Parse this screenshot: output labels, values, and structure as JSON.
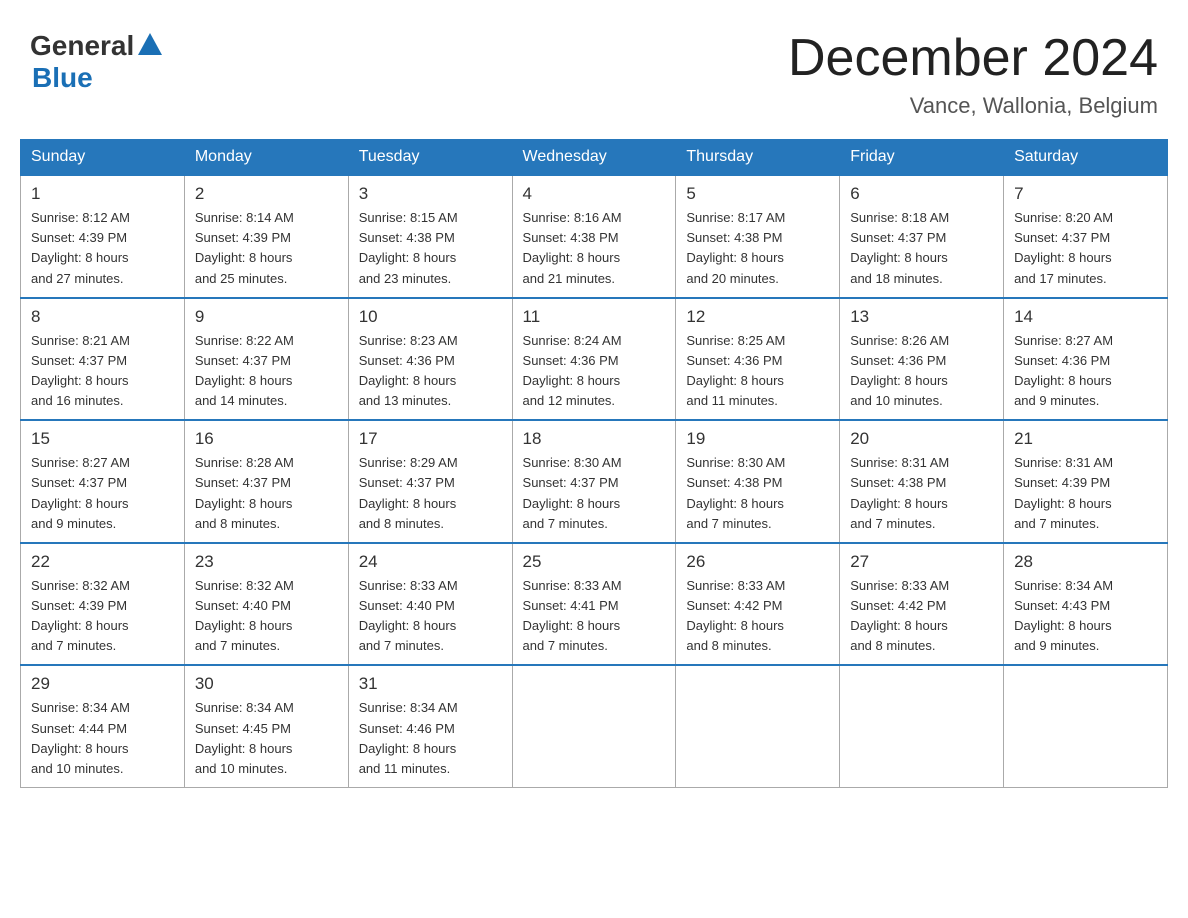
{
  "header": {
    "logo_general": "General",
    "logo_blue": "Blue",
    "title": "December 2024",
    "subtitle": "Vance, Wallonia, Belgium"
  },
  "days_of_week": [
    "Sunday",
    "Monday",
    "Tuesday",
    "Wednesday",
    "Thursday",
    "Friday",
    "Saturday"
  ],
  "weeks": [
    [
      {
        "day": "1",
        "sunrise": "8:12 AM",
        "sunset": "4:39 PM",
        "daylight": "8 hours and 27 minutes."
      },
      {
        "day": "2",
        "sunrise": "8:14 AM",
        "sunset": "4:39 PM",
        "daylight": "8 hours and 25 minutes."
      },
      {
        "day": "3",
        "sunrise": "8:15 AM",
        "sunset": "4:38 PM",
        "daylight": "8 hours and 23 minutes."
      },
      {
        "day": "4",
        "sunrise": "8:16 AM",
        "sunset": "4:38 PM",
        "daylight": "8 hours and 21 minutes."
      },
      {
        "day": "5",
        "sunrise": "8:17 AM",
        "sunset": "4:38 PM",
        "daylight": "8 hours and 20 minutes."
      },
      {
        "day": "6",
        "sunrise": "8:18 AM",
        "sunset": "4:37 PM",
        "daylight": "8 hours and 18 minutes."
      },
      {
        "day": "7",
        "sunrise": "8:20 AM",
        "sunset": "4:37 PM",
        "daylight": "8 hours and 17 minutes."
      }
    ],
    [
      {
        "day": "8",
        "sunrise": "8:21 AM",
        "sunset": "4:37 PM",
        "daylight": "8 hours and 16 minutes."
      },
      {
        "day": "9",
        "sunrise": "8:22 AM",
        "sunset": "4:37 PM",
        "daylight": "8 hours and 14 minutes."
      },
      {
        "day": "10",
        "sunrise": "8:23 AM",
        "sunset": "4:36 PM",
        "daylight": "8 hours and 13 minutes."
      },
      {
        "day": "11",
        "sunrise": "8:24 AM",
        "sunset": "4:36 PM",
        "daylight": "8 hours and 12 minutes."
      },
      {
        "day": "12",
        "sunrise": "8:25 AM",
        "sunset": "4:36 PM",
        "daylight": "8 hours and 11 minutes."
      },
      {
        "day": "13",
        "sunrise": "8:26 AM",
        "sunset": "4:36 PM",
        "daylight": "8 hours and 10 minutes."
      },
      {
        "day": "14",
        "sunrise": "8:27 AM",
        "sunset": "4:36 PM",
        "daylight": "8 hours and 9 minutes."
      }
    ],
    [
      {
        "day": "15",
        "sunrise": "8:27 AM",
        "sunset": "4:37 PM",
        "daylight": "8 hours and 9 minutes."
      },
      {
        "day": "16",
        "sunrise": "8:28 AM",
        "sunset": "4:37 PM",
        "daylight": "8 hours and 8 minutes."
      },
      {
        "day": "17",
        "sunrise": "8:29 AM",
        "sunset": "4:37 PM",
        "daylight": "8 hours and 8 minutes."
      },
      {
        "day": "18",
        "sunrise": "8:30 AM",
        "sunset": "4:37 PM",
        "daylight": "8 hours and 7 minutes."
      },
      {
        "day": "19",
        "sunrise": "8:30 AM",
        "sunset": "4:38 PM",
        "daylight": "8 hours and 7 minutes."
      },
      {
        "day": "20",
        "sunrise": "8:31 AM",
        "sunset": "4:38 PM",
        "daylight": "8 hours and 7 minutes."
      },
      {
        "day": "21",
        "sunrise": "8:31 AM",
        "sunset": "4:39 PM",
        "daylight": "8 hours and 7 minutes."
      }
    ],
    [
      {
        "day": "22",
        "sunrise": "8:32 AM",
        "sunset": "4:39 PM",
        "daylight": "8 hours and 7 minutes."
      },
      {
        "day": "23",
        "sunrise": "8:32 AM",
        "sunset": "4:40 PM",
        "daylight": "8 hours and 7 minutes."
      },
      {
        "day": "24",
        "sunrise": "8:33 AM",
        "sunset": "4:40 PM",
        "daylight": "8 hours and 7 minutes."
      },
      {
        "day": "25",
        "sunrise": "8:33 AM",
        "sunset": "4:41 PM",
        "daylight": "8 hours and 7 minutes."
      },
      {
        "day": "26",
        "sunrise": "8:33 AM",
        "sunset": "4:42 PM",
        "daylight": "8 hours and 8 minutes."
      },
      {
        "day": "27",
        "sunrise": "8:33 AM",
        "sunset": "4:42 PM",
        "daylight": "8 hours and 8 minutes."
      },
      {
        "day": "28",
        "sunrise": "8:34 AM",
        "sunset": "4:43 PM",
        "daylight": "8 hours and 9 minutes."
      }
    ],
    [
      {
        "day": "29",
        "sunrise": "8:34 AM",
        "sunset": "4:44 PM",
        "daylight": "8 hours and 10 minutes."
      },
      {
        "day": "30",
        "sunrise": "8:34 AM",
        "sunset": "4:45 PM",
        "daylight": "8 hours and 10 minutes."
      },
      {
        "day": "31",
        "sunrise": "8:34 AM",
        "sunset": "4:46 PM",
        "daylight": "8 hours and 11 minutes."
      },
      null,
      null,
      null,
      null
    ]
  ],
  "labels": {
    "sunrise_prefix": "Sunrise: ",
    "sunset_prefix": "Sunset: ",
    "daylight_prefix": "Daylight: "
  },
  "colors": {
    "header_bg": "#2677bb",
    "header_text": "#ffffff",
    "border": "#aaaaaa",
    "text": "#333333"
  }
}
